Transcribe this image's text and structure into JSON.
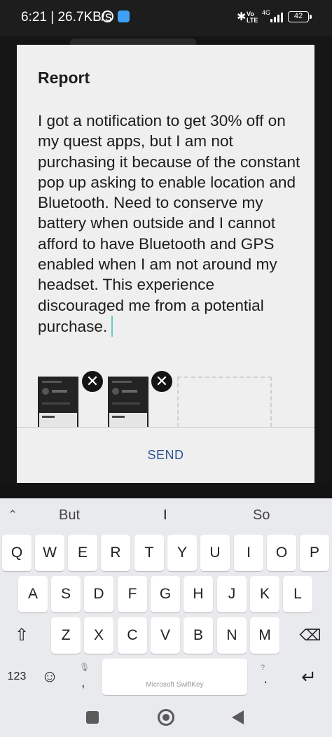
{
  "status_bar": {
    "time_speed": "6:21 | 26.7KB/s",
    "network_badge_top": "Vo",
    "network_badge_bottom": "LTE",
    "network_type": "4G",
    "battery": "42",
    "icons": [
      "alarm-icon",
      "app-notification-icon",
      "bluetooth-icon",
      "signal-icon",
      "battery-icon"
    ]
  },
  "dialog": {
    "title": "Report",
    "body": "I got a notification to get 30% off on my quest apps, but I am not purchasing it because of the constant pop up asking to enable location and Bluetooth. Need to conserve my battery when outside and I cannot afford to have Bluetooth and GPS enabled when I am not around my headset. This experience discouraged me from a potential purchase.",
    "attachment_close_glyph": "✕",
    "send_label": "SEND"
  },
  "keyboard": {
    "suggestions": [
      "But",
      "I",
      "So"
    ],
    "rows": [
      [
        "Q",
        "W",
        "E",
        "R",
        "T",
        "Y",
        "U",
        "I",
        "O",
        "P"
      ],
      [
        "A",
        "S",
        "D",
        "F",
        "G",
        "H",
        "J",
        "K",
        "L"
      ],
      [
        "Z",
        "X",
        "C",
        "V",
        "B",
        "N",
        "M"
      ]
    ],
    "shift_glyph": "⇧",
    "backspace_glyph": "⌫",
    "numbers_label": "123",
    "emoji_glyph": "☺",
    "mic_glyph": "🎙",
    "comma_label": ",",
    "space_label": "Microsoft SwiftKey",
    "question_hint": "?",
    "period_label": ".",
    "enter_glyph": "↵"
  },
  "colors": {
    "accent_send": "#2c5596",
    "caret": "#6cc6c0",
    "dialog_bg": "#efefef",
    "keyboard_bg": "#e9eaed"
  }
}
